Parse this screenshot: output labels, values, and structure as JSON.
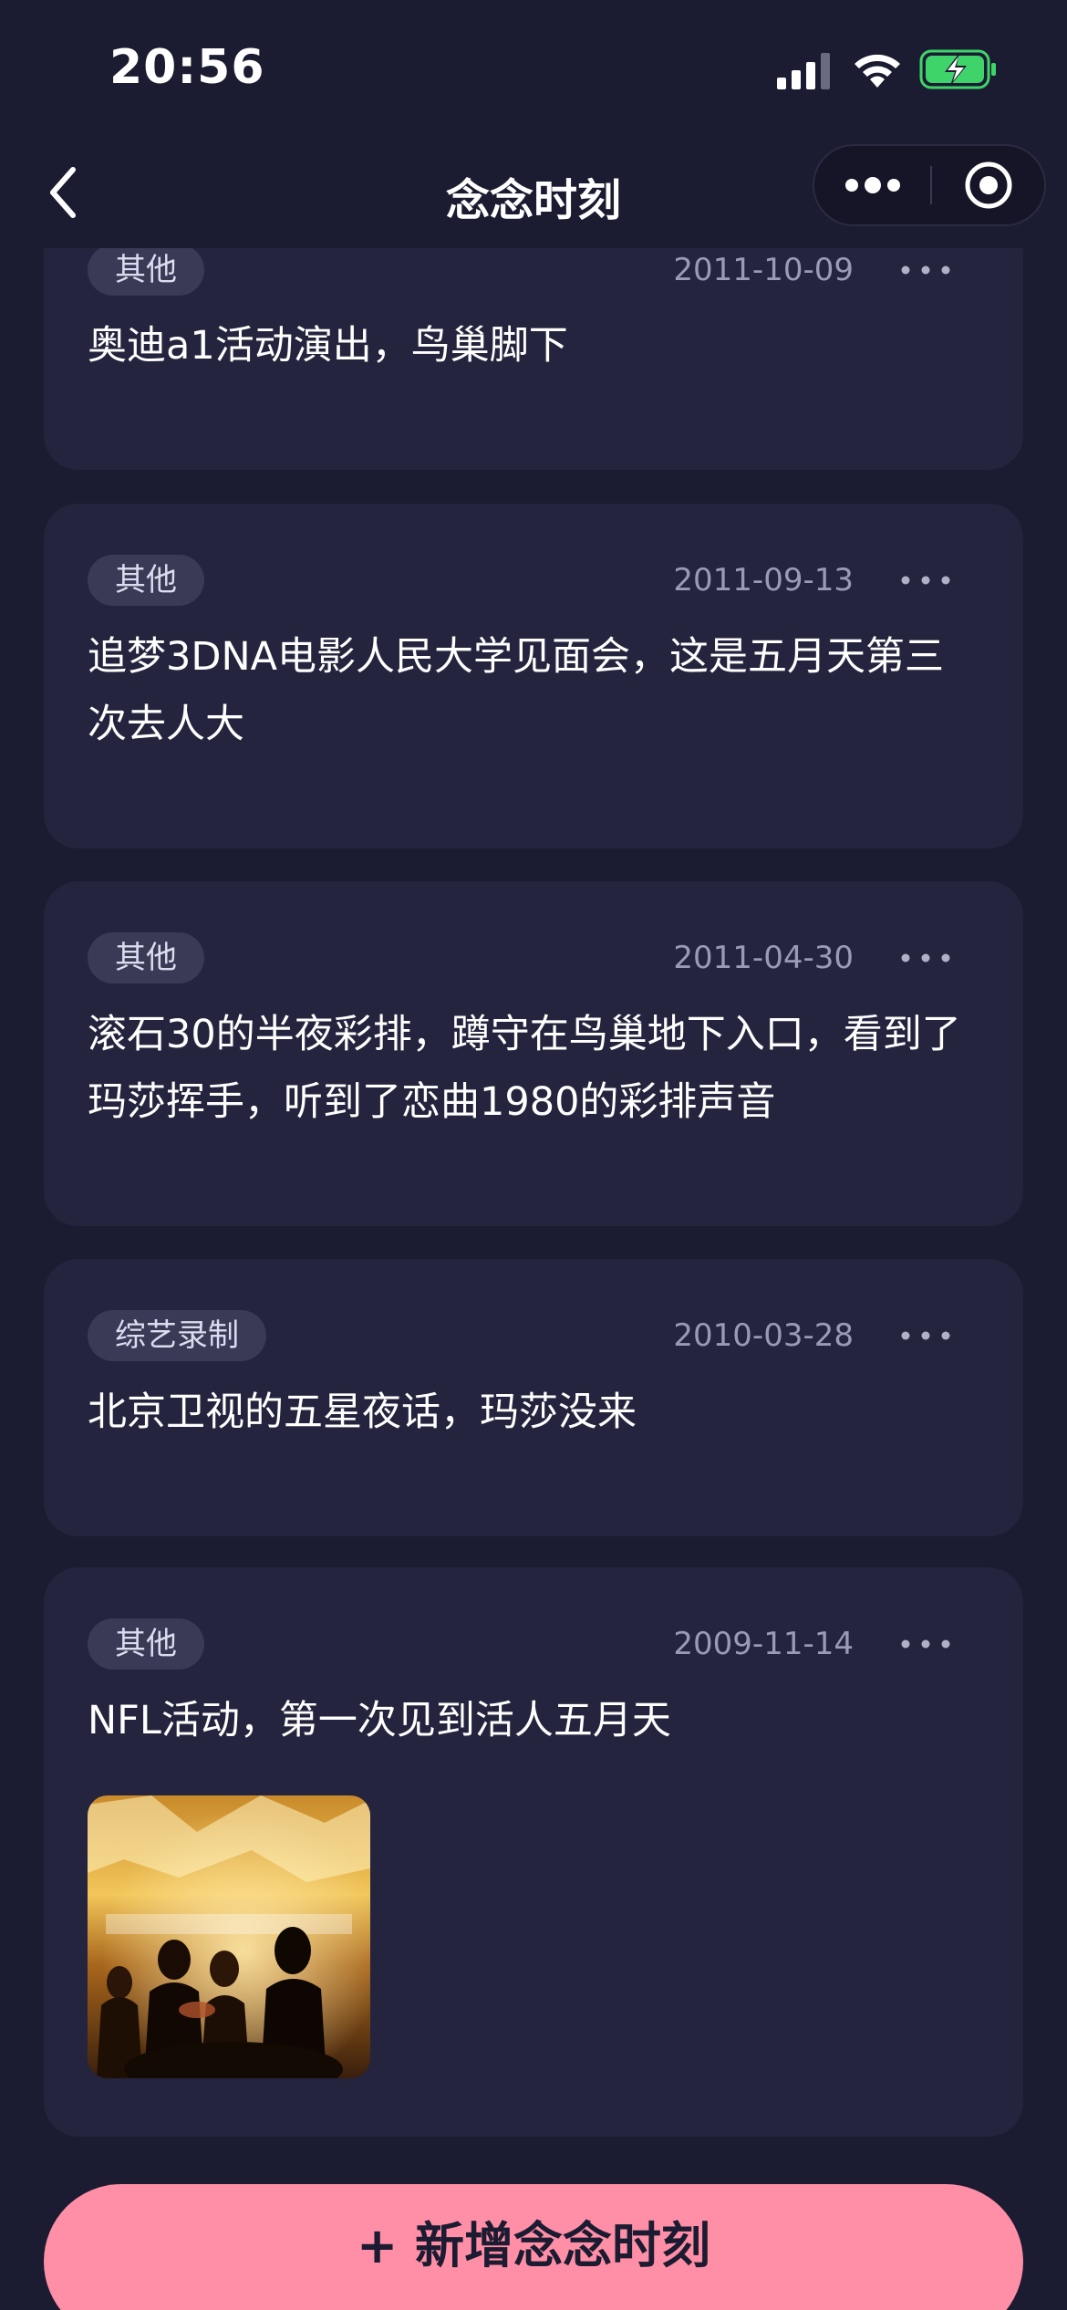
{
  "status_bar": {
    "time": "20:56"
  },
  "nav": {
    "title": "念念时刻",
    "back_icon": "chevron-left-icon",
    "more_icon": "more-dots-icon",
    "close_icon": "target-icon"
  },
  "cards": [
    {
      "tag": "其他",
      "date": "2011-10-09",
      "text": "奥迪a1活动演出，鸟巢脚下"
    },
    {
      "tag": "其他",
      "date": "2011-09-13",
      "text": "追梦3DNA电影人民大学见面会，这是五月天第三次去人大"
    },
    {
      "tag": "其他",
      "date": "2011-04-30",
      "text": "滚石30的半夜彩排，蹲守在鸟巢地下入口，看到了玛莎挥手，听到了恋曲1980的彩排声音"
    },
    {
      "tag": "综艺录制",
      "date": "2010-03-28",
      "text": "北京卫视的五星夜话，玛莎没来"
    },
    {
      "tag": "其他",
      "date": "2009-11-14",
      "text": "NFL活动，第一次见到活人五月天",
      "has_photo": true
    }
  ],
  "add_button": {
    "label": "+ 新增念念时刻"
  },
  "colors": {
    "background": "#1b1b31",
    "card": "#24243e",
    "tag": "#3a3a56",
    "accent": "#ff8fa6",
    "battery": "#3fd46a"
  }
}
